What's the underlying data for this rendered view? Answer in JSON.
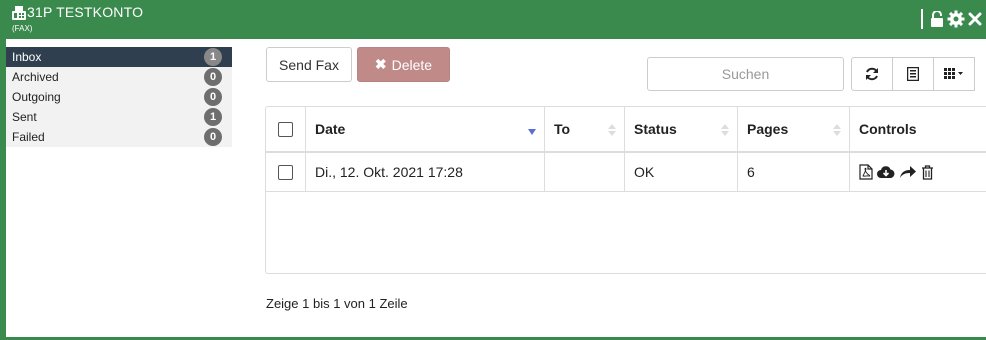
{
  "window": {
    "title": "31P TESTKONTO",
    "subtitle": "(FAX)",
    "title_icon": "fax-icon",
    "actions": [
      "unlock-icon",
      "gear-icon",
      "close-icon"
    ]
  },
  "colors": {
    "header": "#3a8a4e",
    "sidebar_active": "#2f3f4f",
    "delete_button": "#c08a89",
    "badge": "#6e6e6e"
  },
  "sidebar": {
    "items": [
      {
        "label": "Inbox",
        "count": "1",
        "active": true
      },
      {
        "label": "Archived",
        "count": "0",
        "active": false
      },
      {
        "label": "Outgoing",
        "count": "0",
        "active": false
      },
      {
        "label": "Sent",
        "count": "1",
        "active": false
      },
      {
        "label": "Failed",
        "count": "0",
        "active": false
      }
    ]
  },
  "toolbar": {
    "send_label": "Send Fax",
    "delete_label": "Delete",
    "delete_icon": "times-icon",
    "search_placeholder": "Suchen",
    "tools": [
      "refresh-icon",
      "list-icon",
      "columns-icon"
    ]
  },
  "table": {
    "columns": [
      "Date",
      "To",
      "Status",
      "Pages",
      "Controls"
    ],
    "sorted_column": "Date",
    "rows": [
      {
        "date": "Di., 12. Okt. 2021 17:28",
        "to": "",
        "status": "OK",
        "pages": "6",
        "controls": [
          "pdf-icon",
          "cloud-download-icon",
          "forward-icon",
          "trash-icon"
        ]
      }
    ]
  },
  "footer": {
    "text": "Zeige 1 bis 1 von 1 Zeile"
  }
}
